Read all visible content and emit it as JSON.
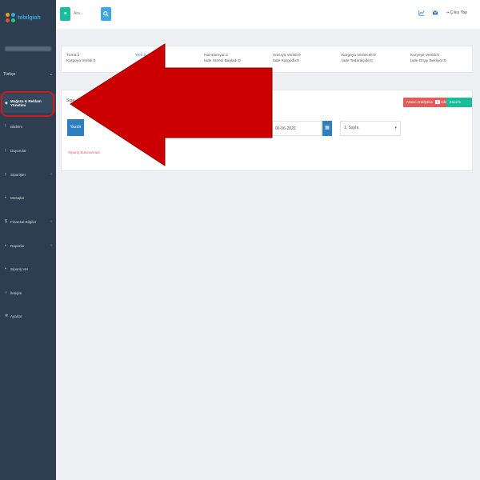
{
  "app": {
    "logo_text": "tebilgiah"
  },
  "sidebar": {
    "user_name": "",
    "language": "Türkçe",
    "items": [
      {
        "label": "Mağaza & Reklam Yönetimi",
        "icon": "tag-icon",
        "active": true
      },
      {
        "label": "Bildirim",
        "icon": "bell-icon"
      },
      {
        "label": "Duyurular",
        "icon": "megaphone-icon"
      },
      {
        "label": "Siparişler",
        "icon": "cart-icon",
        "has_children": true
      },
      {
        "label": "Mesajlar",
        "icon": "mail-icon"
      },
      {
        "label": "Finansal Bilgiler",
        "icon": "dollar-icon",
        "has_children": true
      },
      {
        "label": "Raporlar",
        "icon": "report-icon",
        "has_children": true
      },
      {
        "label": "Sipariş Ver",
        "icon": "cart-icon"
      },
      {
        "label": "İletişim",
        "icon": "headset-icon"
      },
      {
        "label": "Ayarlar",
        "icon": "gear-icon"
      }
    ]
  },
  "topbar": {
    "search_placeholder": "Ara...",
    "logout_label": "Çıkış Yap"
  },
  "status": [
    {
      "line1": "Tümü:2",
      "line2": "Kargoya Verildi:0"
    },
    {
      "line1": "Yeni S...",
      "line2": ""
    },
    {
      "line1": "Hazırlanıyor:2",
      "line2": "İade Süreci Başladı:0"
    },
    {
      "line1": "Aracıya Verildi:0",
      "line2": "İade Kargoda:0"
    },
    {
      "line1": "Kargoya Verilecek:0",
      "line2": "İade Tedarikçide:0"
    },
    {
      "line1": "Kuryeye Verildi:0",
      "line2": "İade Onay Bekliyor:0"
    }
  ],
  "orders": {
    "title": "Sipa...",
    "filter_button": "Aracıcı Entityrice",
    "badge_count": "0",
    "badge_suffix": "Adet",
    "excel_button": "Excel'e Aktar",
    "print_button": "Yazdır",
    "date_value": "06-06-2020",
    "page_selected": "1. Sayfa",
    "empty_message": "Sipariş Bulunamadı"
  },
  "colors": {
    "sidebar_bg": "#2c3e50",
    "accent_green": "#1abc9c",
    "accent_blue": "#2d7fc1",
    "alert_red": "#e05d5d",
    "arrow_red": "#cc0000"
  }
}
